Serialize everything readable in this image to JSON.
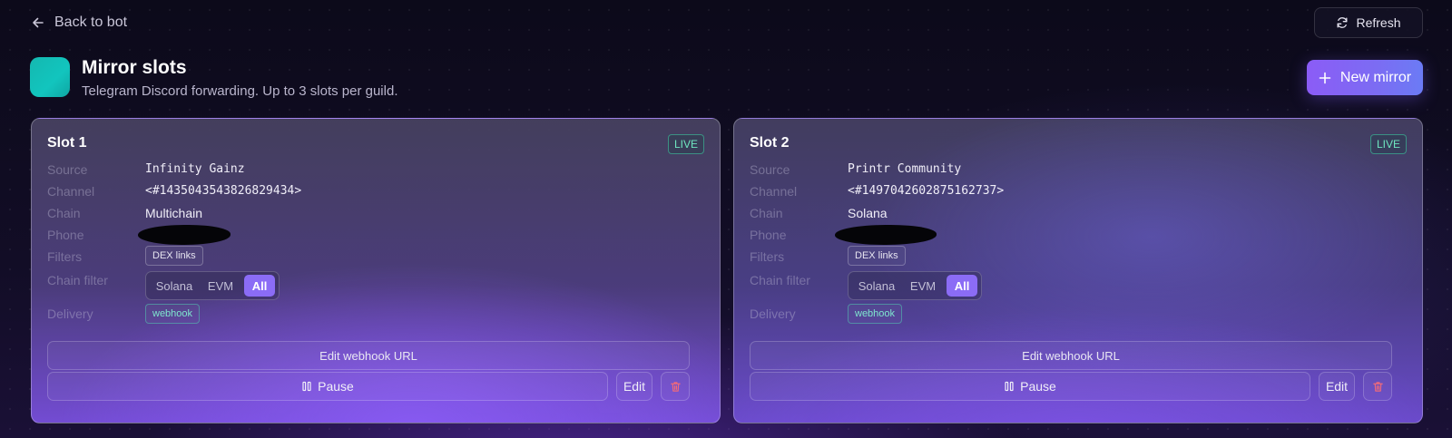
{
  "nav": {
    "back_label": "Back to bot",
    "refresh_label": "Refresh"
  },
  "header": {
    "title": "Mirror slots",
    "subtitle": "Telegram Discord forwarding. Up to 3 slots per guild.",
    "new_button_label": "New mirror"
  },
  "labels": {
    "source": "Source",
    "channel": "Channel",
    "chain": "Chain",
    "phone": "Phone",
    "filters": "Filters",
    "chain_filter": "Chain filter",
    "delivery": "Delivery"
  },
  "slots": [
    {
      "title": "Slot 1",
      "status": "LIVE",
      "source": "Infinity Gainz",
      "channel": "<#1435043543826829434>",
      "chain": "Multichain",
      "filter_chip": "DEX links",
      "chain_filter_options": [
        "Solana",
        "EVM",
        "All"
      ],
      "chain_filter_selected": "All",
      "delivery": "webhook",
      "edit_webhook_label": "Edit webhook URL",
      "pause_label": "Pause",
      "edit_label": "Edit"
    },
    {
      "title": "Slot 2",
      "status": "LIVE",
      "source": "Printr Community",
      "channel": "<#1497042602875162737>",
      "chain": "Solana",
      "filter_chip": "DEX links",
      "chain_filter_options": [
        "Solana",
        "EVM",
        "All"
      ],
      "chain_filter_selected": "All",
      "delivery": "webhook",
      "edit_webhook_label": "Edit webhook URL",
      "pause_label": "Pause",
      "edit_label": "Edit"
    }
  ],
  "colors": {
    "accent": "#8b5cf6",
    "live_green": "#6fe6c0",
    "header_icon_teal": "#14b8b0",
    "delete_red": "#f06a7a"
  },
  "icons": {
    "back": "arrow-left-icon",
    "refresh": "refresh-icon",
    "new": "plus-icon",
    "pause": "pause-icon",
    "delete": "trash-icon"
  }
}
